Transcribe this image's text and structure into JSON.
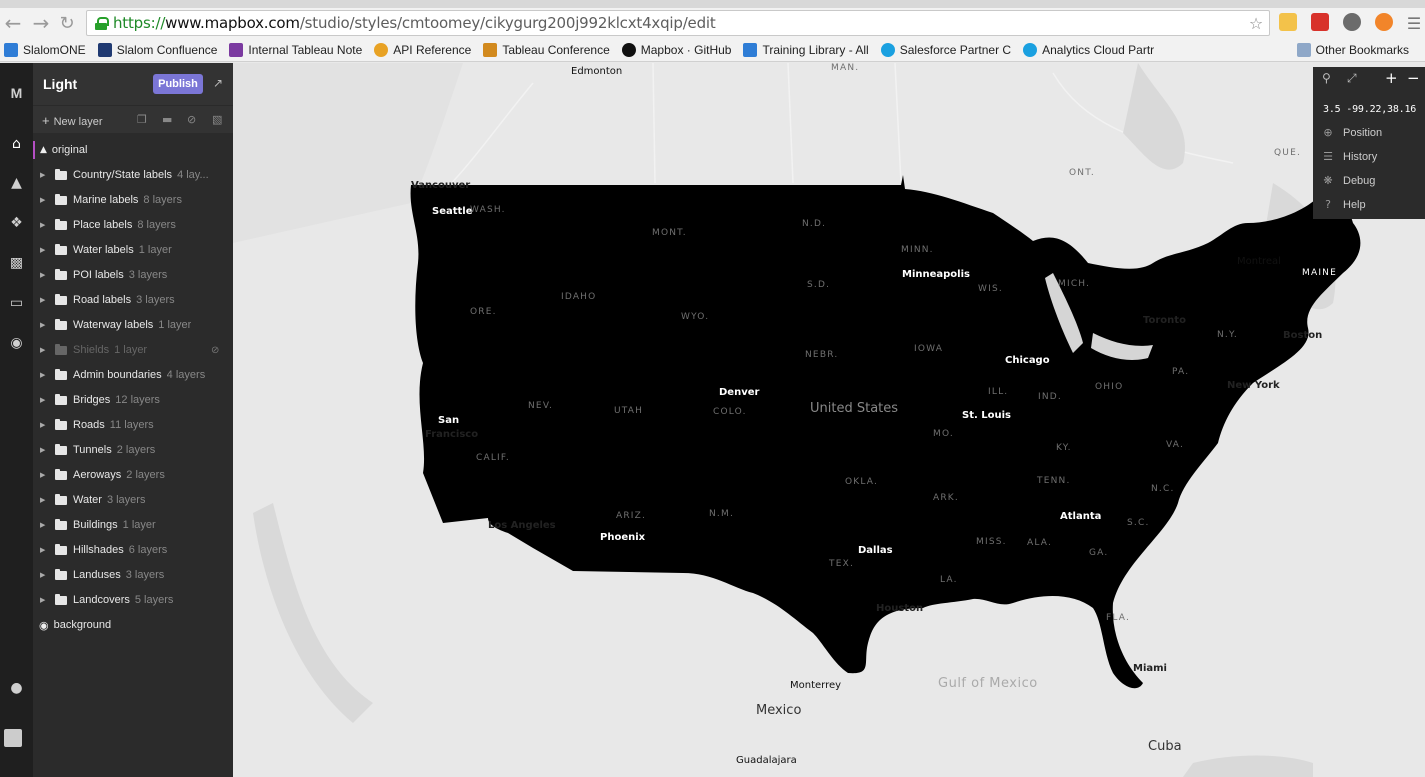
{
  "browser": {
    "url_scheme": "https://",
    "url_host": "www.mapbox.com",
    "url_path": "/studio/styles/cmtoomey/cikygurg200j992klcxt4xqip/edit",
    "bookmarks": [
      {
        "label": "SlalomONE",
        "icon_color": "#2f7dd6"
      },
      {
        "label": "Slalom Confluence",
        "icon_color": "#203a72"
      },
      {
        "label": "Internal Tableau Note",
        "icon_color": "#7b3aa0"
      },
      {
        "label": "API Reference",
        "icon_color": "#e8a224"
      },
      {
        "label": "Tableau Conference",
        "icon_color": "#d28a1e"
      },
      {
        "label": "Mapbox · GitHub",
        "icon_color": "#111111"
      },
      {
        "label": "Training Library - All",
        "icon_color": "#2f7dd6"
      },
      {
        "label": "Salesforce Partner C",
        "icon_color": "#1aa0e0"
      },
      {
        "label": "Analytics Cloud Partr",
        "icon_color": "#1aa0e0"
      }
    ],
    "other_bookmarks": "Other Bookmarks"
  },
  "studio": {
    "style_name": "Light",
    "publish_label": "Publish",
    "new_layer_label": "New layer",
    "original_label": "original",
    "background_label": "background",
    "groups": [
      {
        "name": "Country/State labels",
        "count": "4 lay..."
      },
      {
        "name": "Marine labels",
        "count": "8 layers"
      },
      {
        "name": "Place labels",
        "count": "8 layers"
      },
      {
        "name": "Water labels",
        "count": "1 layer"
      },
      {
        "name": "POI labels",
        "count": "3 layers"
      },
      {
        "name": "Road labels",
        "count": "3 layers"
      },
      {
        "name": "Waterway labels",
        "count": "1 layer"
      },
      {
        "name": "Shields",
        "count": "1 layer",
        "hidden": true
      },
      {
        "name": "Admin boundaries",
        "count": "4 layers"
      },
      {
        "name": "Bridges",
        "count": "12 layers"
      },
      {
        "name": "Roads",
        "count": "11 layers"
      },
      {
        "name": "Tunnels",
        "count": "2 layers"
      },
      {
        "name": "Aeroways",
        "count": "2 layers"
      },
      {
        "name": "Water",
        "count": "3 layers"
      },
      {
        "name": "Buildings",
        "count": "1 layer"
      },
      {
        "name": "Hillshades",
        "count": "6 layers"
      },
      {
        "name": "Landuses",
        "count": "3 layers"
      },
      {
        "name": "Landcovers",
        "count": "5 layers"
      }
    ]
  },
  "map_controls": {
    "coords": "3.5 -99.22,38.16",
    "position_label": "Position",
    "history_label": "History",
    "debug_label": "Debug",
    "help_label": "Help"
  },
  "map_labels": {
    "edmonton": "Edmonton",
    "man": "MAN.",
    "vancouver": "Vancouver",
    "seattle": "Seattle",
    "wash": "WASH.",
    "ont": "ONT.",
    "que": "QUE.",
    "mont": "MONT.",
    "nd": "N.D.",
    "minn": "MINN.",
    "minneapolis": "Minneapolis",
    "montreal": "Montreal",
    "maine": "MAINE",
    "idaho": "IDAHO",
    "sd": "S.D.",
    "wis": "WIS.",
    "mich": "MICH.",
    "toronto": "Toronto",
    "ore": "ORE.",
    "wyo": "WYO.",
    "ny": "N.Y.",
    "boston": "Boston",
    "nebr": "NEBR.",
    "iowa": "IOWA",
    "chicago": "Chicago",
    "pa": "PA.",
    "newyork": "New York",
    "denver": "Denver",
    "us": "United States",
    "ohio": "OHIO",
    "nev": "NEV.",
    "utah": "UTAH",
    "colo": "COLO.",
    "ill": "ILL.",
    "ind": "IND.",
    "stlouis": "St. Louis",
    "sf1": "San",
    "sf2": "Francisco",
    "mo": "MO.",
    "va": "VA.",
    "ky": "KY.",
    "calif": "CALIF.",
    "okla": "OKLA.",
    "tenn": "TENN.",
    "nc": "N.C.",
    "ark": "ARK.",
    "arizona": "ARIZ.",
    "nm": "N.M.",
    "atlanta": "Atlanta",
    "sc": "S.C.",
    "la_city": "Los Angeles",
    "phoenix": "Phoenix",
    "miss": "MISS.",
    "ala": "ALA.",
    "ga": "GA.",
    "dallas": "Dallas",
    "tex": "TEX.",
    "la": "LA.",
    "houston": "Houston",
    "fla": "FLA.",
    "miami": "Miami",
    "monterrey": "Monterrey",
    "gulf": "Gulf of Mexico",
    "mexico": "Mexico",
    "cuba": "Cuba",
    "guadalajara": "Guadalajara"
  }
}
